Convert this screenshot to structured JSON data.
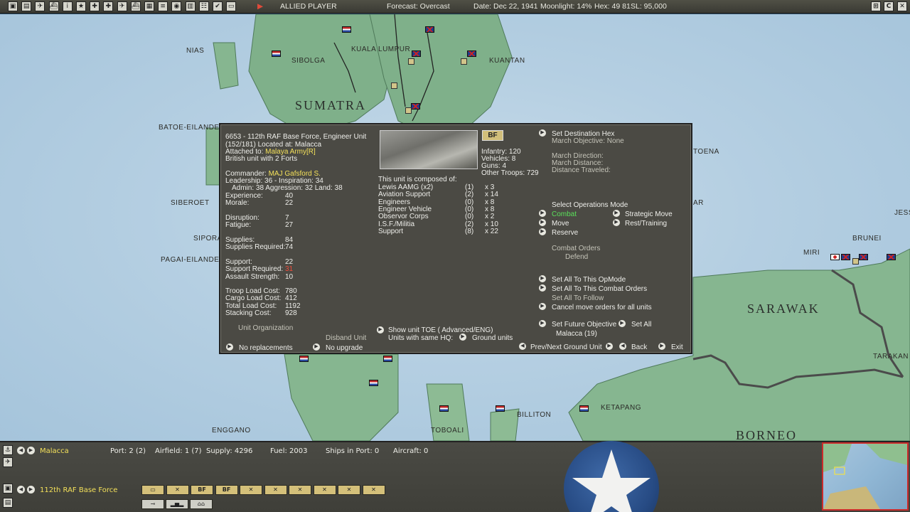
{
  "topbar": {
    "icons": [
      "save-icon",
      "report-icon",
      "air-icon",
      "ship-icon",
      "info-icon",
      "star-icon",
      "cross-icon",
      "cross-icon-2",
      "plane-icon",
      "ship-icon-2",
      "cargo-icon",
      "chart-icon",
      "globe-icon",
      "bases-icon",
      "list-icon",
      "ok-icon",
      "screen-icon"
    ],
    "player": "ALLIED PLAYER",
    "forecast": "Forecast: Overcast",
    "date": "Date: Dec 22, 1941",
    "moonlight": "Moonlight: 14%",
    "hex": "Hex: 49 81",
    "sl": "SL: 95,000",
    "window_buttons": [
      "⊞",
      "C",
      "✕"
    ]
  },
  "map": {
    "labels": [
      "NIAS",
      "SIBOLGA",
      "KUALA LUMPUR",
      "KUANTAN",
      "SUMATRA",
      "BATOE-EILANDEN",
      "TOENA",
      "SIBEROET",
      "SIPORA",
      "PAGAI-EILANDEN",
      "MIRI",
      "BRUNEI",
      "SARAWAK",
      "TARAKAN",
      "ENGGANO",
      "TOBOALI",
      "BILLITON",
      "KETAPANG",
      "BORNEO",
      "JESS",
      "AR"
    ]
  },
  "dialog": {
    "header_line1": "6653 - 112th RAF Base Force, Engineer Unit",
    "header_line2": "(152/181) Located at: Malacca",
    "attached_prefix": "Attached to: ",
    "attached_value": "Malaya Army[R]",
    "forts": "British unit with 2 Forts",
    "commander_prefix": "Commander: ",
    "commander_value": "MAJ Gafsford S.",
    "leadership": "Leadership: 36 - Inspiration: 34",
    "admin": "Admin: 38  Aggression: 32  Land: 38",
    "stats": [
      {
        "label": "Experience:",
        "value": "40"
      },
      {
        "label": "Morale:",
        "value": "22"
      }
    ],
    "stats2": [
      {
        "label": "Disruption:",
        "value": "7"
      },
      {
        "label": "Fatigue:",
        "value": "27"
      }
    ],
    "stats3": [
      {
        "label": "Supplies:",
        "value": "84"
      },
      {
        "label": "Supplies Required:",
        "value": "74"
      }
    ],
    "stats4": [
      {
        "label": "Support:",
        "value": "22"
      },
      {
        "label": "Support Required:",
        "value": "31"
      },
      {
        "label": "Assault Strength:",
        "value": "10"
      }
    ],
    "stats5": [
      {
        "label": "Troop Load Cost:",
        "value": "780"
      },
      {
        "label": "Cargo Load Cost:",
        "value": "412"
      },
      {
        "label": "Total Load Cost:",
        "value": "1192"
      },
      {
        "label": "Stacking Cost:",
        "value": "928"
      }
    ],
    "unit_org": "Unit Organization",
    "disband": "Disband Unit",
    "no_replacements": "No replacements",
    "no_upgrade": "No upgrade",
    "badge": "BF",
    "counts": [
      "Infantry: 120",
      "Vehicles: 8",
      "Guns: 4",
      "Other Troops: 729"
    ],
    "composed_title": "This unit is composed of:",
    "composition": [
      {
        "name": "Lewis AAMG (x2)",
        "dmg": "(1)",
        "count": "x 3"
      },
      {
        "name": "Aviation Support",
        "dmg": "(2)",
        "count": "x 14"
      },
      {
        "name": "Engineers",
        "dmg": "(0)",
        "count": "x 8"
      },
      {
        "name": "Engineer Vehicle",
        "dmg": "(0)",
        "count": "x 8"
      },
      {
        "name": "Observor Corps",
        "dmg": "(0)",
        "count": "x 2"
      },
      {
        "name": "I.S.F./Militia",
        "dmg": "(2)",
        "count": "x 10"
      },
      {
        "name": "Support",
        "dmg": "(8)",
        "count": "x 22"
      }
    ],
    "show_toe": "Show unit TOE ( Advanced/ENG)",
    "same_hq": "Units with same HQ:",
    "ground_units": "Ground units",
    "set_destination": "Set Destination Hex",
    "march_objective": "March Objective: None",
    "march_direction": "March Direction:",
    "march_distance": "March Distance:",
    "distance_traveled": "Distance Traveled:",
    "select_ops": "Select Operations Mode",
    "mode_combat": "Combat",
    "mode_move": "Move",
    "mode_reserve": "Reserve",
    "mode_strategic": "Strategic Move",
    "mode_rest": "Rest/Training",
    "combat_orders": "Combat Orders",
    "defend": "Defend",
    "set_all_opmode": "Set All To This OpMode",
    "set_all_combat": "Set All To This Combat Orders",
    "set_all_follow": "Set All To Follow",
    "cancel_move": "Cancel move orders for all units",
    "set_future": "Set Future Objective",
    "set_all": "Set All",
    "future_value": "Malacca (19)",
    "prev_next": "Prev/Next Ground Unit",
    "back": "Back",
    "exit": "Exit"
  },
  "bottom": {
    "location": "Malacca",
    "port": "Port: 2 (2)",
    "airfield": "Airfield: 1 (7)",
    "supply": "Supply: 4296",
    "fuel": "Fuel: 2003",
    "ships": "Ships in Port: 0",
    "aircraft": "Aircraft: 0",
    "unit_name": "112th RAF Base Force",
    "slots": [
      "▭",
      "✕",
      "BF",
      "BF",
      "✕",
      "✕",
      "✕",
      "✕",
      "✕",
      "✕"
    ]
  },
  "colors": {
    "panel": "#4b4a44",
    "highlight_yellow": "#f3e05a",
    "warning_red": "#f04a3a",
    "active_green": "#5ae05a",
    "land_green": "#7fb07f",
    "sea_blue": "#b5cfe2"
  }
}
